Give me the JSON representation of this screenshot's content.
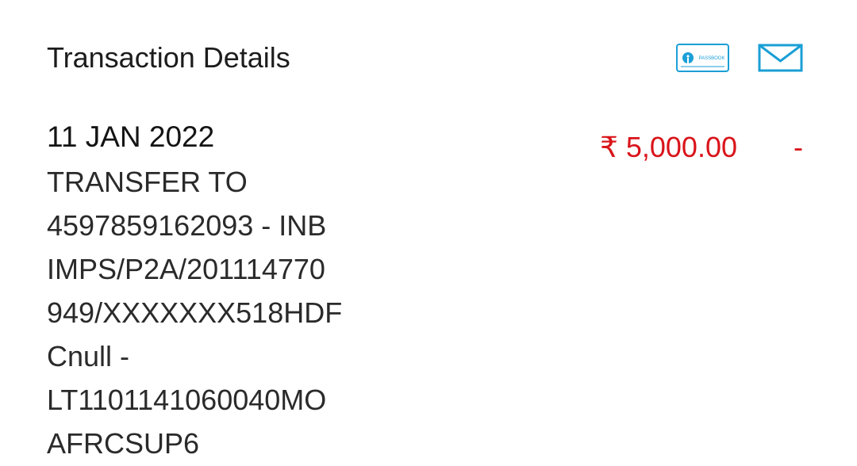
{
  "header": {
    "title": "Transaction Details",
    "passbook_icon_label": "PASSBOOK",
    "icons": [
      "passbook-icon",
      "mail-icon"
    ],
    "accent_color": "#1a9fd6"
  },
  "transaction": {
    "date": "11 JAN 2022",
    "description_lines": [
      "TRANSFER TO",
      "4597859162093 - INB",
      "IMPS/P2A/201114770",
      "949/XXXXXXX518HDF",
      "Cnull -",
      "LT1101141060040MO",
      "AFRCSUP6"
    ],
    "amount": "₹ 5,000.00",
    "type_indicator": "-",
    "amount_color": "#d9141a"
  }
}
